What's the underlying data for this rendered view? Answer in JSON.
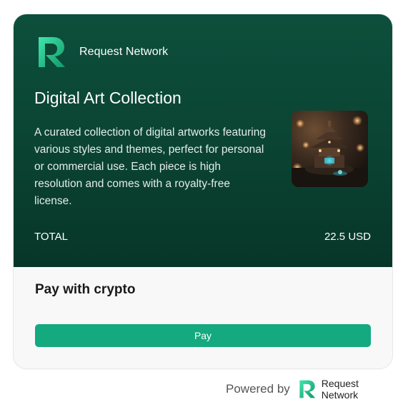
{
  "brand": {
    "name": "Request Network",
    "logo_icon": "request-network-logo"
  },
  "product": {
    "title": "Digital Art Collection",
    "description": "A curated collection of digital artworks featuring various styles and themes, perfect for personal or commercial use. Each piece is high resolution and comes with a royalty-free license.",
    "image_icon": "digital-art-thumbnail"
  },
  "total": {
    "label": "TOTAL",
    "amount": "22.5 USD"
  },
  "payment": {
    "heading": "Pay with crypto",
    "button_label": "Pay"
  },
  "footer": {
    "powered_by": "Powered by",
    "brand_line1": "Request",
    "brand_line2": "Network"
  },
  "colors": {
    "card_top": "#0b4433",
    "accent": "#14a97f",
    "logo_gradient_start": "#3ee0a8",
    "logo_gradient_end": "#0d8a5f"
  }
}
